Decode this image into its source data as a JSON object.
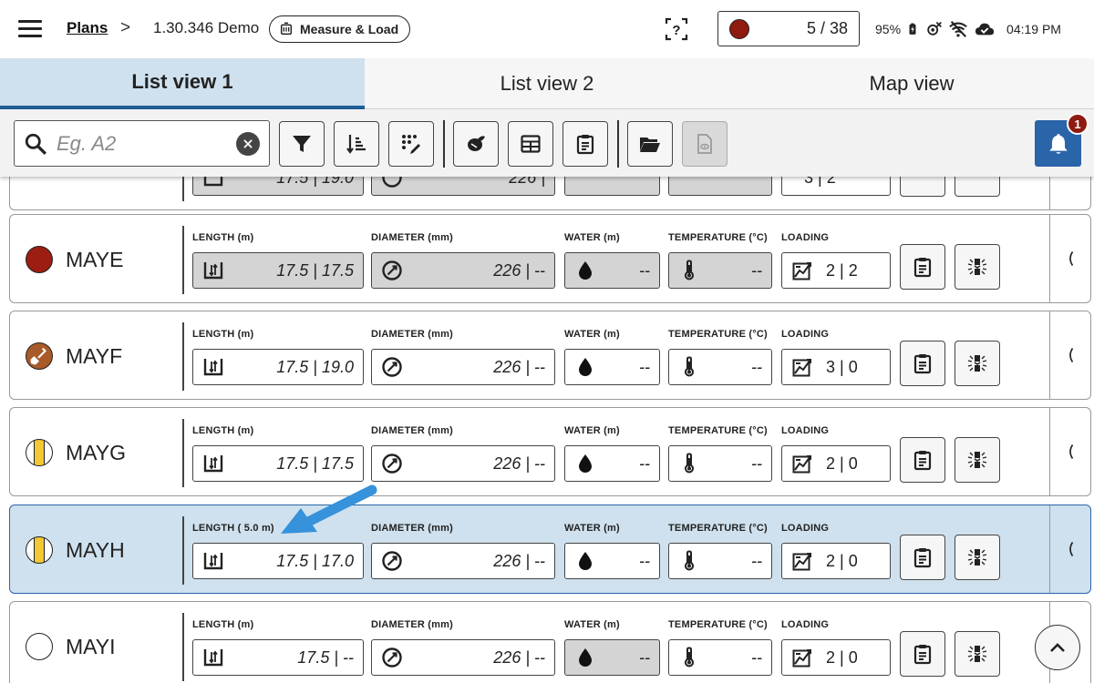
{
  "header": {
    "breadcrumb_root": "Plans",
    "breadcrumb_sep": ">",
    "project": "1.30.346 Demo",
    "mode_label": "Measure & Load",
    "counter_text": "5 / 38",
    "counter_color": "#8e1a10",
    "battery": "95%",
    "time": "04:19 PM"
  },
  "tabs": [
    {
      "label": "List view 1",
      "active": true
    },
    {
      "label": "List view 2",
      "active": false
    },
    {
      "label": "Map view",
      "active": false
    }
  ],
  "toolbar": {
    "search_placeholder": "Eg. A2",
    "notification_count": "1",
    "buttons": [
      "filter-icon",
      "sort-icon",
      "dots-edit-icon",
      "plant-icon",
      "table-icon",
      "clipboard-icon",
      "folder-icon",
      "document-view-icon"
    ]
  },
  "labels": {
    "length": "LENGTH (m)",
    "diameter": "DIAMETER (mm)",
    "water": "WATER (m)",
    "temperature": "TEMPERATURE (°C)",
    "loading": "LOADING"
  },
  "partial_row": {
    "length": "17.5 | 19.0",
    "diameter": "226 |",
    "loading": "3 | 2"
  },
  "rows": [
    {
      "name": "MAYE",
      "marker": "red",
      "length_label": "LENGTH (m)",
      "length": "17.5 | 17.5",
      "diameter": "226 | --",
      "water": "--",
      "temperature": "--",
      "loading": "2 | 2",
      "grey_fields": [
        "length",
        "diameter",
        "water",
        "temperature"
      ],
      "selected": false
    },
    {
      "name": "MAYF",
      "marker": "brown-shovel",
      "length_label": "LENGTH (m)",
      "length": "17.5 | 19.0",
      "diameter": "226 | --",
      "water": "--",
      "temperature": "--",
      "loading": "3 | 0",
      "grey_fields": [],
      "selected": false
    },
    {
      "name": "MAYG",
      "marker": "yellow-striped",
      "length_label": "LENGTH (m)",
      "length": "17.5 | 17.5",
      "diameter": "226 | --",
      "water": "--",
      "temperature": "--",
      "loading": "2 | 0",
      "grey_fields": [],
      "selected": false
    },
    {
      "name": "MAYH",
      "marker": "yellow-striped",
      "length_label": "LENGTH ( 5.0 m)",
      "length": "17.5 | 17.0",
      "diameter": "226 | --",
      "water": "--",
      "temperature": "--",
      "loading": "2 | 0",
      "grey_fields": [],
      "selected": true
    },
    {
      "name": "MAYI",
      "marker": "empty",
      "length_label": "LENGTH (m)",
      "length": "17.5 | --",
      "diameter": "226 | --",
      "water": "--",
      "temperature": "--",
      "loading": "2 | 0",
      "grey_fields": [
        "water"
      ],
      "selected": false
    }
  ],
  "colors": {
    "accent": "#2a64a9",
    "selected_row": "#cfe1ee",
    "annotation_arrow": "#3592db",
    "marker_red": "#9c1d12",
    "marker_brown": "#a85a28",
    "marker_yellow": "#f2c834"
  }
}
